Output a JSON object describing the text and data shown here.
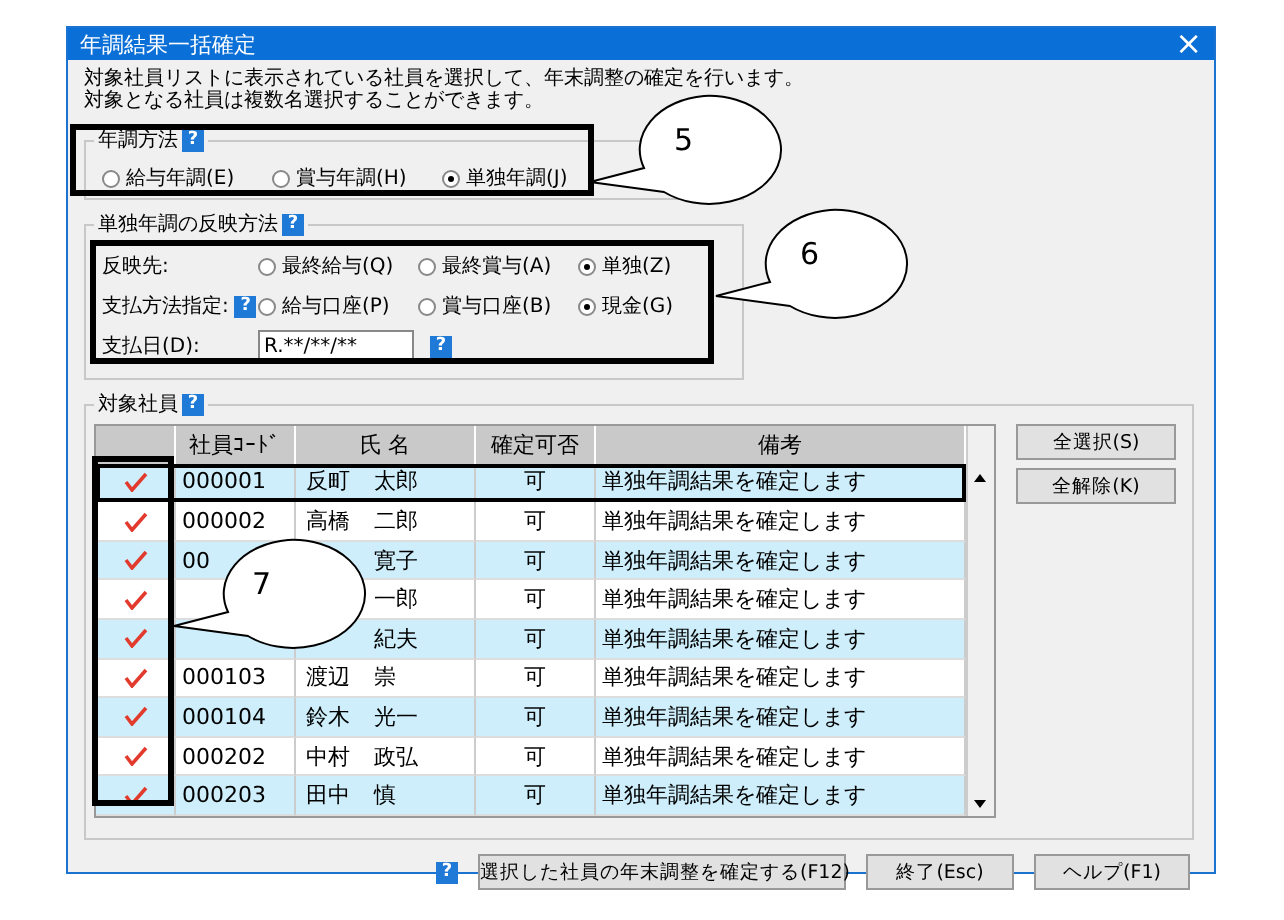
{
  "window": {
    "title": "年調結果一括確定",
    "close": "×"
  },
  "description": [
    "対象社員リストに表示されている社員を選択して、年末調整の確定を行います。",
    "対象となる社員は複数名選択することができます。"
  ],
  "method": {
    "label": "年調方法",
    "help": "?",
    "options": [
      {
        "label": "給与年調(E)",
        "selected": false
      },
      {
        "label": "賞与年調(H)",
        "selected": false
      },
      {
        "label": "単独年調(J)",
        "selected": true
      }
    ]
  },
  "reflection": {
    "label": "単独年調の反映方法",
    "help": "?",
    "target": {
      "label": "反映先:",
      "options": [
        {
          "label": "最終給与(Q)",
          "selected": false
        },
        {
          "label": "最終賞与(A)",
          "selected": false
        },
        {
          "label": "単独(Z)",
          "selected": true
        }
      ]
    },
    "payment": {
      "label": "支払方法指定:",
      "help": "?",
      "options": [
        {
          "label": "給与口座(P)",
          "selected": false
        },
        {
          "label": "賞与口座(B)",
          "selected": false
        },
        {
          "label": "現金(G)",
          "selected": true
        }
      ]
    },
    "date": {
      "label": "支払日(D):",
      "value": "R.**/**/**",
      "help": "?"
    }
  },
  "employees": {
    "label": "対象社員",
    "help": "?",
    "columns": [
      "社員ｺｰﾄﾞ",
      "氏 名",
      "確定可否",
      "備考"
    ],
    "rows": [
      {
        "checked": true,
        "selected": true,
        "code": "000001",
        "family": "反町",
        "given": "太郎",
        "status": "可",
        "note": "単独年調結果を確定します"
      },
      {
        "checked": true,
        "selected": false,
        "code": "000002",
        "family": "高橋",
        "given": "二郎",
        "status": "可",
        "note": "単独年調結果を確定します"
      },
      {
        "checked": true,
        "selected": false,
        "code": "00",
        "given": "寛子",
        "status": "可",
        "note": "単独年調結果を確定します"
      },
      {
        "checked": true,
        "selected": false,
        "given": "一郎",
        "status": "可",
        "note": "単独年調結果を確定します"
      },
      {
        "checked": true,
        "selected": false,
        "given": "紀夫",
        "status": "可",
        "note": "単独年調結果を確定します"
      },
      {
        "checked": true,
        "selected": false,
        "code": "000103",
        "family": "渡辺",
        "given": "崇",
        "status": "可",
        "note": "単独年調結果を確定します"
      },
      {
        "checked": true,
        "selected": false,
        "code": "000104",
        "family": "鈴木",
        "given": "光一",
        "status": "可",
        "note": "単独年調結果を確定します"
      },
      {
        "checked": true,
        "selected": false,
        "code": "000202",
        "family": "中村",
        "given": "政弘",
        "status": "可",
        "note": "単独年調結果を確定します"
      },
      {
        "checked": true,
        "selected": false,
        "code": "000203",
        "family": "田中",
        "given": "慎",
        "status": "可",
        "note": "単独年調結果を確定します"
      }
    ],
    "side_buttons": [
      "全選択(S)",
      "全解除(K)"
    ]
  },
  "footer": {
    "help": "?",
    "buttons": [
      "選択した社員の年末調整を確定する(F12)",
      "終了(Esc)",
      "ヘルプ(F1)"
    ]
  },
  "callouts": [
    "5",
    "6",
    "7"
  ]
}
